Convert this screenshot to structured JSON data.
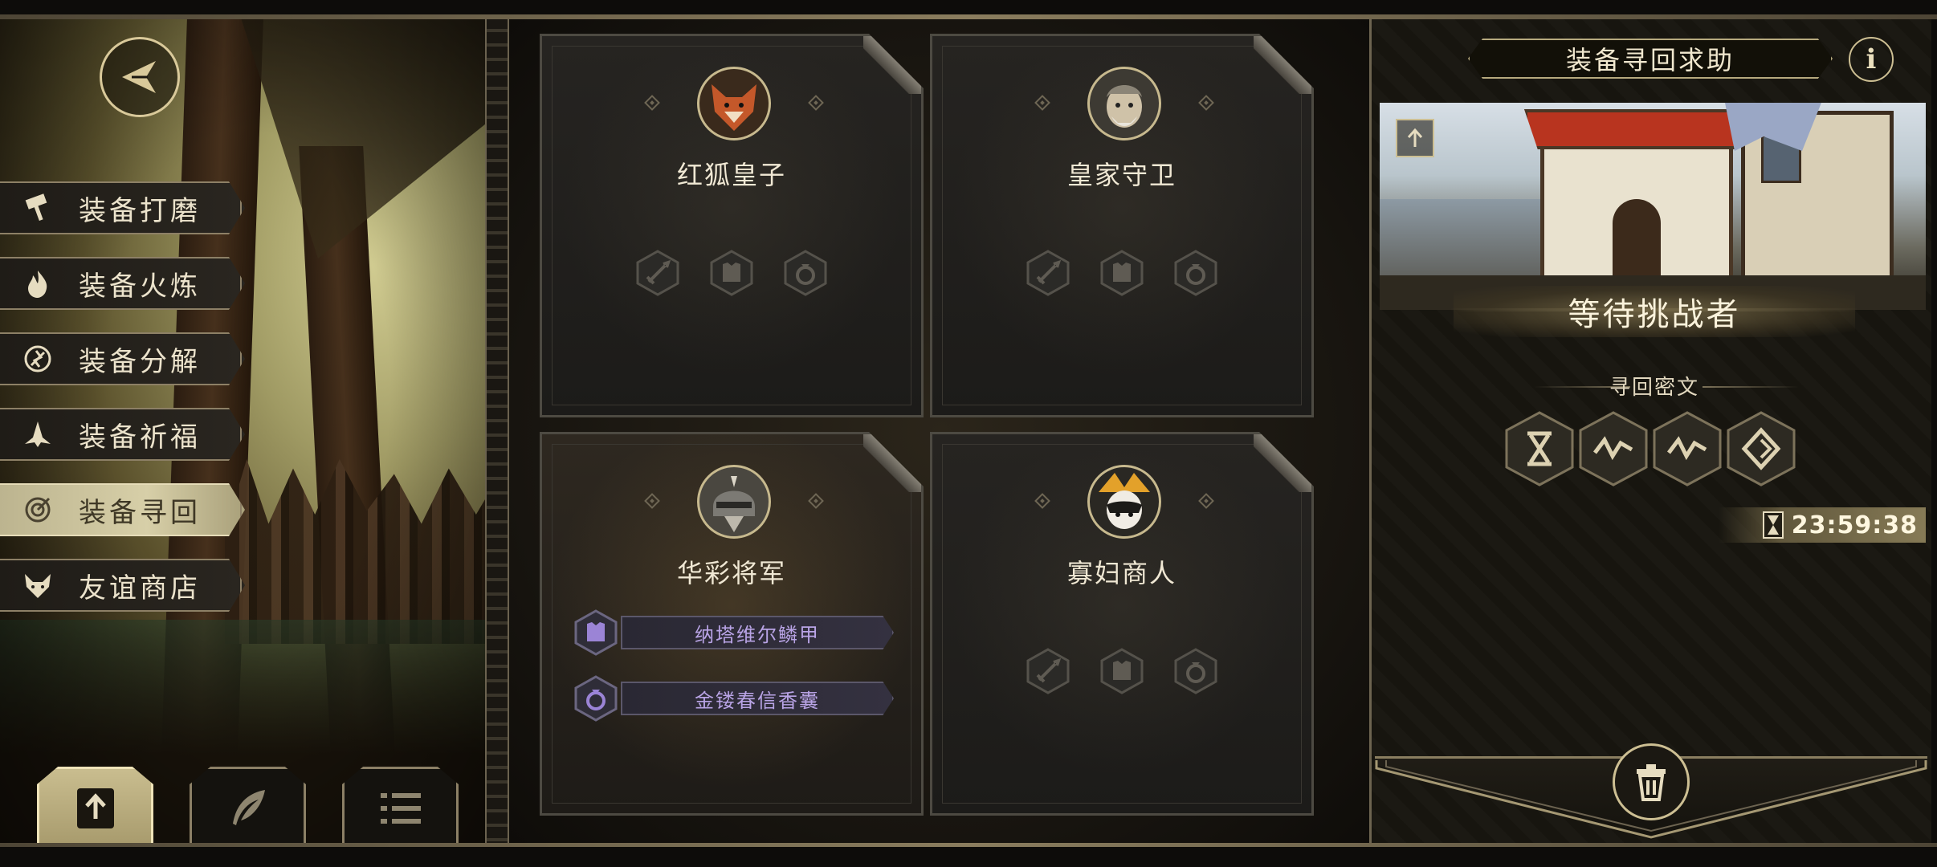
{
  "colors": {
    "gold": "#d9c99a",
    "menu_active": "#d7cfa8",
    "equip_text": "#b9a4e6",
    "card_bg": "#262421"
  },
  "nav": {
    "back_icon": "back-arrow-icon",
    "menu": [
      {
        "label": "装备打磨",
        "icon": "hammer-icon",
        "active": false
      },
      {
        "label": "装备火炼",
        "icon": "flame-icon",
        "active": false
      },
      {
        "label": "装备分解",
        "icon": "decompose-icon",
        "active": false
      },
      {
        "label": "装备祈福",
        "icon": "pray-icon",
        "active": false
      },
      {
        "label": "装备寻回",
        "icon": "retrieve-icon",
        "active": true
      },
      {
        "label": "友谊商店",
        "icon": "fox-icon",
        "active": false
      }
    ],
    "bottom_buttons": [
      {
        "icon": "upload-icon",
        "active": true
      },
      {
        "icon": "feather-icon",
        "active": false
      },
      {
        "icon": "list-icon",
        "active": false
      }
    ]
  },
  "cards": [
    {
      "name": "红狐皇子",
      "avatar": "red-fox-avatar",
      "slots": [
        "sword-slot-icon",
        "armor-slot-icon",
        "ring-slot-icon"
      ],
      "equipment": []
    },
    {
      "name": "皇家守卫",
      "avatar": "royal-guard-avatar",
      "slots": [
        "sword-slot-icon",
        "armor-slot-icon",
        "ring-slot-icon"
      ],
      "equipment": []
    },
    {
      "name": "华彩将军",
      "avatar": "general-avatar",
      "slots": [],
      "equipment": [
        {
          "name": "纳塔维尔鳞甲",
          "icon": "armor-icon"
        },
        {
          "name": "金镂春信香囊",
          "icon": "ring-icon"
        }
      ]
    },
    {
      "name": "寡妇商人",
      "avatar": "widow-merchant-avatar",
      "slots": [
        "sword-slot-icon",
        "armor-slot-icon",
        "ring-slot-icon"
      ],
      "equipment": []
    }
  ],
  "right_panel": {
    "title": "装备寻回求助",
    "info_label": "i",
    "status": "等待挑战者",
    "runes_title": "寻回密文",
    "runes": [
      "rune-x-icon",
      "rune-wave-icon",
      "rune-wave-icon",
      "rune-diamond-icon"
    ],
    "timer": "23:59:38"
  }
}
